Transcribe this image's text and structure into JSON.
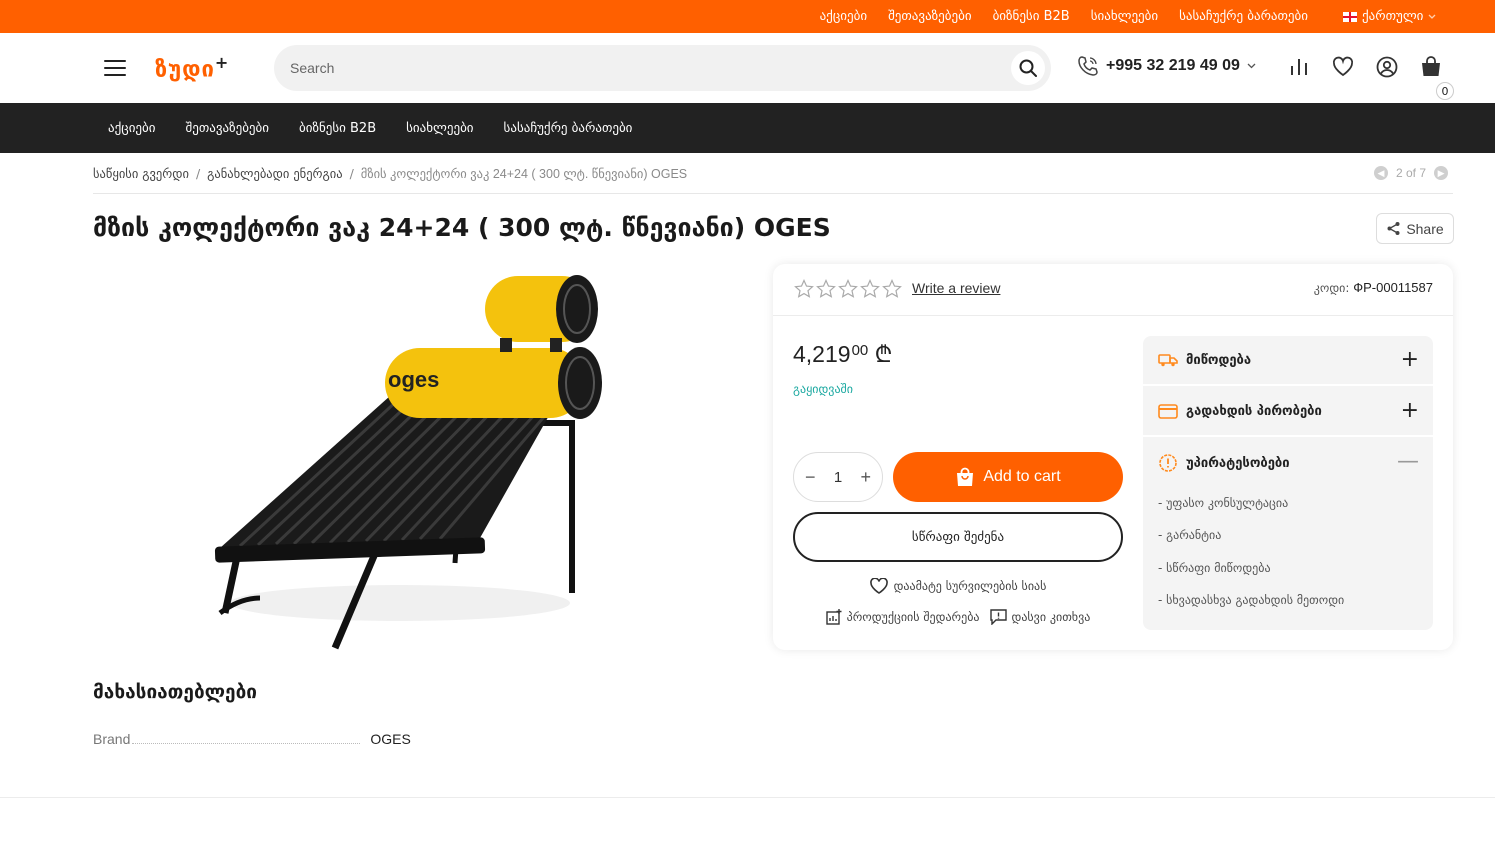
{
  "topbar": {
    "links": [
      "აქციები",
      "შეთავაზებები",
      "ბიზნესი B2B",
      "სიახლეები",
      "სასაჩუქრე ბარათები"
    ],
    "language": "ქართული"
  },
  "header": {
    "logo": "ზუდი",
    "logo_plus": "+",
    "search_placeholder": "Search",
    "phone": "+995 32 219 49 09",
    "cart_count": "0",
    "accent_color": "#ff6000"
  },
  "nav": {
    "items": [
      "აქციები",
      "შეთავაზებები",
      "ბიზნესი B2B",
      "სიახლეები",
      "სასაჩუქრე ბარათები"
    ]
  },
  "breadcrumb": {
    "items": [
      "საწყისი გვერდი",
      "განახლებადი ენერგია",
      "მზის კოლექტორი ვაკ 24+24 ( 300 ლტ. წნევიანი) OGES"
    ],
    "separator": "/",
    "pager": "2 of 7"
  },
  "product": {
    "title": "მზის კოლექტორი ვაკ 24+24 ( 300 ლტ. წნევიანი) OGES",
    "share_label": "Share",
    "image_brand": "oges",
    "rating": 0,
    "review_link": "Write a review",
    "code_label": "კოდი:",
    "code_value": "ФР-00011587",
    "price_int": "4,219",
    "price_dec": "00",
    "currency": "₾",
    "status": "გაყიდვაში",
    "quantity": "1",
    "add_to_cart": "Add to cart",
    "quick_buy": "სწრაფი შეძენა",
    "wishlist": "დაამატე სურვილების სიას",
    "compare": "პროდუქციის შედარება",
    "ask": "დასვი კითხვა"
  },
  "accordion": {
    "delivery": "მიწოდება",
    "payment": "გადახდის პირობები",
    "advantages": "უპირატესობები",
    "advantage_items": [
      "- უფასო კონსულტაცია",
      "- გარანტია",
      "- სწრაფი მიწოდება",
      "- სხვადასხვა გადახდის მეთოდი"
    ]
  },
  "specs": {
    "title": "მახასიათებლები",
    "rows": [
      {
        "key": "Brand",
        "value": "OGES"
      }
    ]
  }
}
